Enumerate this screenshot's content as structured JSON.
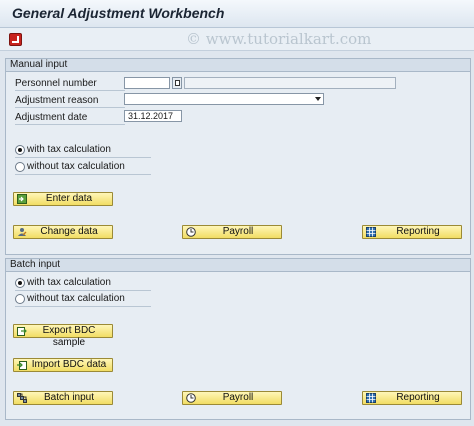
{
  "window": {
    "title": "General Adjustment Workbench"
  },
  "watermark": "© www.tutorialkart.com",
  "manual": {
    "header": "Manual input",
    "personnel_label": "Personnel number",
    "personnel_value": "",
    "reason_label": "Adjustment reason",
    "reason_value": "",
    "date_label": "Adjustment date",
    "date_value": "31.12.2017",
    "radio_with": "with tax calculation",
    "radio_without": "without tax calculation",
    "selected_radio": "with",
    "enter_data": "Enter data",
    "change_data": "Change data",
    "payroll": "Payroll",
    "reporting": "Reporting"
  },
  "batch": {
    "header": "Batch input",
    "radio_with": "with tax calculation",
    "radio_without": "without tax calculation",
    "selected_radio": "with",
    "export_bdc": "Export BDC sample",
    "import_bdc": "Import BDC data",
    "batch_input": "Batch input",
    "payroll": "Payroll",
    "reporting": "Reporting"
  },
  "colors": {
    "button_fill": "#f1dd63",
    "execute_icon": "#c8231e"
  },
  "icons": {
    "execute": "execute-icon",
    "enter": "enter-data-icon",
    "change": "change-data-icon",
    "payroll": "payroll-clock-icon",
    "reporting": "reporting-grid-icon",
    "export": "export-icon",
    "import": "import-icon",
    "batch": "batch-input-icon"
  }
}
